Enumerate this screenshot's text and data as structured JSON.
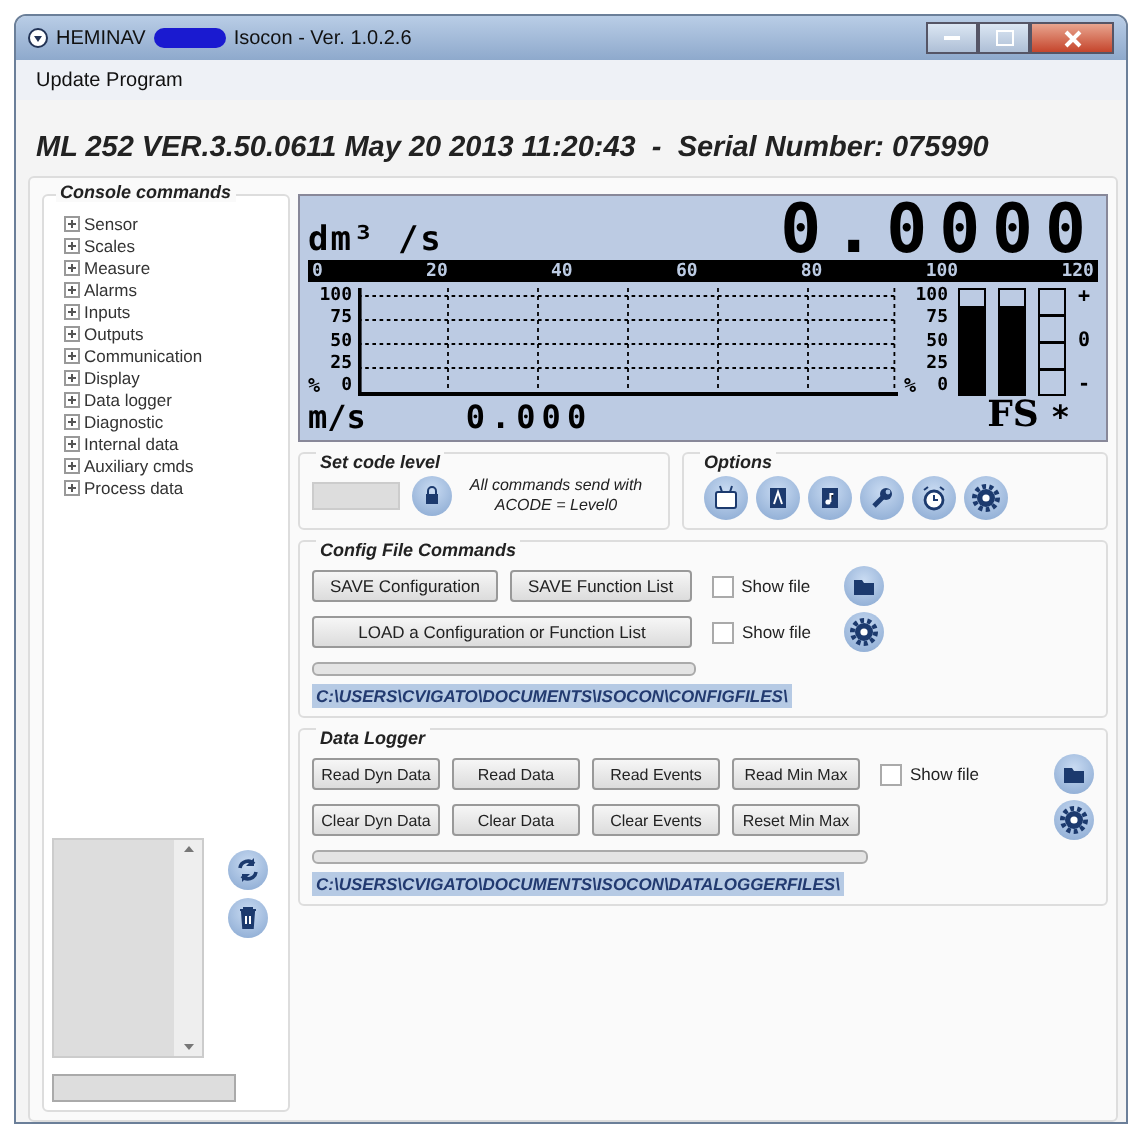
{
  "window": {
    "title_start": "HEMINAV",
    "title_end": "Isocon - Ver. 1.0.2.6"
  },
  "menu": [
    "Update Program"
  ],
  "header": "ML 252 VER.3.50.0611 May 20 2013 11:20:43  -  Serial Number: 075990",
  "console": {
    "title": "Console commands",
    "items": [
      {
        "label": "Sensor",
        "expanded": false
      },
      {
        "label": "Scales",
        "expanded": false
      },
      {
        "label": "Measure",
        "expanded": false
      },
      {
        "label": "Alarms",
        "expanded": false
      },
      {
        "label": "Inputs",
        "expanded": false
      },
      {
        "label": "Outputs",
        "expanded": false
      },
      {
        "label": "Communication",
        "expanded": false
      },
      {
        "label": "Display",
        "expanded": false
      },
      {
        "label": "Data logger",
        "expanded": false
      },
      {
        "label": "Diagnostic",
        "expanded": false
      },
      {
        "label": "Internal data",
        "expanded": false
      },
      {
        "label": "Auxiliary cmds",
        "expanded": false
      },
      {
        "label": "Process data",
        "expanded": false
      }
    ]
  },
  "lcd": {
    "unit": "dm³ /s",
    "value": "0.0000",
    "scale": [
      "0",
      "20",
      "40",
      "60",
      "80",
      "100",
      "120"
    ],
    "axis": [
      "100",
      "75",
      "50",
      "25",
      "0"
    ],
    "percent": "%",
    "right_axis": [
      "100",
      "75",
      "50",
      "25",
      "0"
    ],
    "right_percent": "%",
    "bars": [
      {
        "level": 0.85
      },
      {
        "level": 0.85
      }
    ],
    "meter": [
      "+",
      "0",
      "-"
    ],
    "sub_unit": "m/s",
    "sub_value": "0.000",
    "fs": "FS",
    "star": "*"
  },
  "code_level": {
    "title": "Set code level",
    "note": "All commands send with ACODE = Level0"
  },
  "options": {
    "title": "Options"
  },
  "config": {
    "title": "Config File Commands",
    "save_buttons": [
      "SAVE Configuration",
      "SAVE Function List"
    ],
    "load_button": "LOAD a Configuration or Function List",
    "show_file": [
      {
        "label": "Show file",
        "checked": false
      },
      {
        "label": "Show file",
        "checked": false
      }
    ],
    "progress": {
      "level": 0
    },
    "path": "C:\\USERS\\CVIGATO\\DOCUMENTS\\ISOCON\\CONFIGFILES\\"
  },
  "logger": {
    "title": "Data Logger",
    "read_buttons": [
      "Read Dyn Data",
      "Read Data",
      "Read Events",
      "Read Min Max"
    ],
    "clear_buttons": [
      "Clear Dyn Data",
      "Clear Data",
      "Clear Events",
      "Reset Min Max"
    ],
    "show_file": {
      "label": "Show file",
      "checked": false
    },
    "progress": {
      "level": 0
    },
    "path": "C:\\USERS\\CVIGATO\\DOCUMENTS\\ISOCON\\DATALOGGERFILES\\"
  }
}
